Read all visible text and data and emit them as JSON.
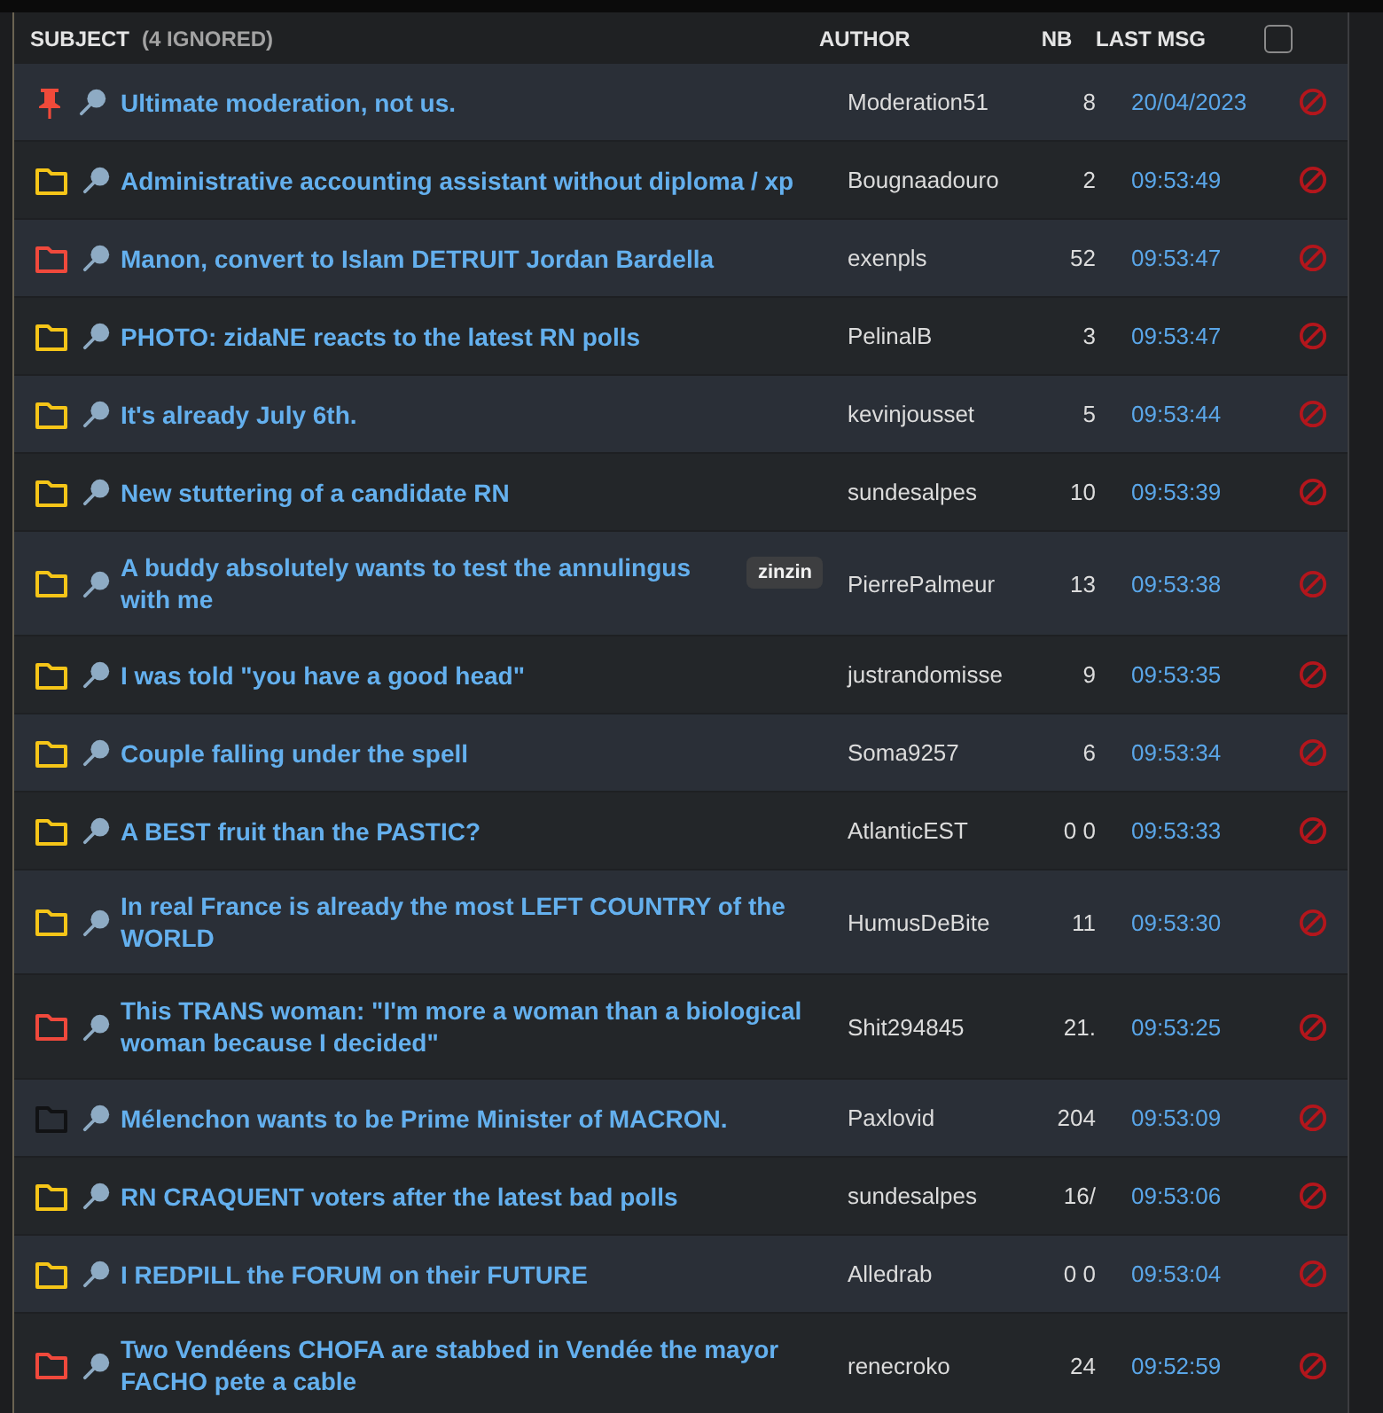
{
  "header": {
    "subject": "SUBJECT",
    "ignored": "(4 IGNORED)",
    "author": "AUTHOR",
    "nb": "NB",
    "last_msg": "LAST MSG",
    "select_all": {
      "checked": false
    }
  },
  "topics": [
    {
      "kind": "pin",
      "color": "#f04a3a",
      "title": "Ultimate moderation, not us.",
      "author": "Moderation51",
      "nb": "8",
      "last_msg": "20/04/2023"
    },
    {
      "kind": "folder",
      "color": "#f5c518",
      "title": "Administrative accounting assistant without diploma / xp",
      "author": "Bougnaadouro",
      "nb": "2",
      "last_msg": "09:53:49"
    },
    {
      "kind": "folder",
      "color": "#f0493c",
      "title": "Manon, convert to Islam DETRUIT Jordan Bardella",
      "author": "exenpls",
      "nb": "52",
      "last_msg": "09:53:47"
    },
    {
      "kind": "folder",
      "color": "#f5c518",
      "title": "PHOTO: zidaNE reacts to the latest RN polls",
      "author": "PelinalB",
      "nb": "3",
      "last_msg": "09:53:47"
    },
    {
      "kind": "folder",
      "color": "#f5c518",
      "title": "It's already July 6th.",
      "author": "kevinjousset",
      "nb": "5",
      "last_msg": "09:53:44"
    },
    {
      "kind": "folder",
      "color": "#f5c518",
      "title": "New stuttering of a candidate RN",
      "author": "sundesalpes",
      "nb": "10",
      "last_msg": "09:53:39"
    },
    {
      "kind": "folder",
      "color": "#f5c518",
      "title": "A buddy absolutely wants to test the annulingus with me",
      "badge": "zinzin",
      "author": "PierrePalmeur",
      "nb": "13",
      "last_msg": "09:53:38"
    },
    {
      "kind": "folder",
      "color": "#f5c518",
      "title": "I was told \"you have a good head\"",
      "author": "justrandomisse",
      "nb": "9",
      "last_msg": "09:53:35"
    },
    {
      "kind": "folder",
      "color": "#f5c518",
      "title": "Couple falling under the spell",
      "author": "Soma9257",
      "nb": "6",
      "last_msg": "09:53:34"
    },
    {
      "kind": "folder",
      "color": "#f5c518",
      "title": "A BEST fruit than the PASTIC?",
      "author": "AtlanticEST",
      "nb": "0 0",
      "last_msg": "09:53:33"
    },
    {
      "kind": "folder",
      "color": "#f5c518",
      "title": "In real France is already the most LEFT COUNTRY of the WORLD",
      "author": "HumusDeBite",
      "nb": "11",
      "last_msg": "09:53:30"
    },
    {
      "kind": "folder",
      "color": "#f0493c",
      "title": "This TRANS woman: \"I'm more a woman than a biological woman because I decided\"",
      "author": "Shit294845",
      "nb": "21.",
      "last_msg": "09:53:25"
    },
    {
      "kind": "folder",
      "color": "#111214",
      "title": "Mélenchon wants to be Prime Minister of MACRON.",
      "author": "Paxlovid",
      "nb": "204",
      "last_msg": "09:53:09"
    },
    {
      "kind": "folder",
      "color": "#f5c518",
      "title": "RN CRAQUENT voters after the latest bad polls",
      "author": "sundesalpes",
      "nb": "16/",
      "last_msg": "09:53:06"
    },
    {
      "kind": "folder",
      "color": "#f5c518",
      "title": "I REDPILL the FORUM on their FUTURE",
      "author": "Alledrab",
      "nb": "0 0",
      "last_msg": "09:53:04"
    },
    {
      "kind": "folder",
      "color": "#f0493c",
      "title": "Two Vendéens CHOFA are stabbed in Vendée the mayor FACHO pete a cable",
      "author": "renecroko",
      "nb": "24",
      "last_msg": "09:52:59"
    }
  ]
}
